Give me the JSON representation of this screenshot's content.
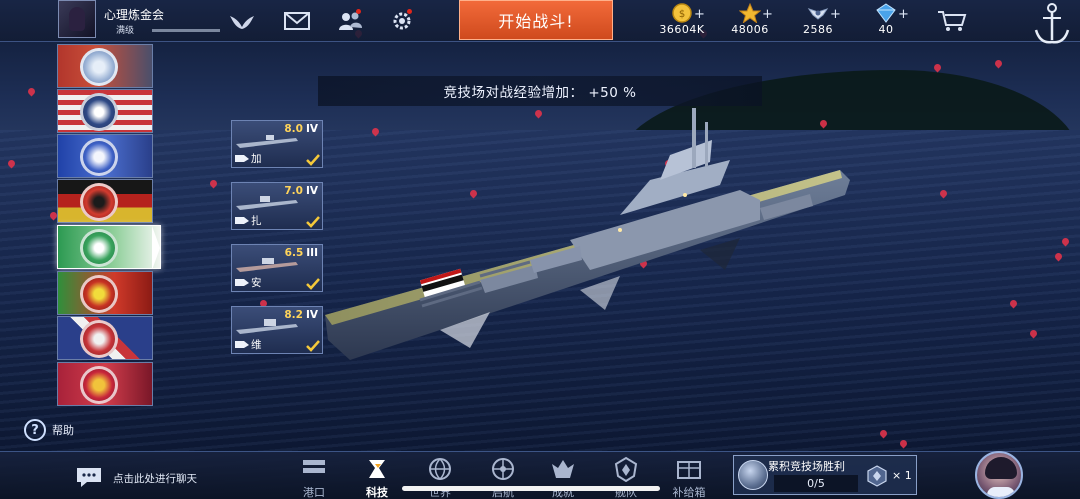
{
  "player": {
    "name": "心理炼金会",
    "level_text": "满级"
  },
  "top": {
    "start_battle_label": "开始战斗!"
  },
  "resources": [
    {
      "icon": "gold-coin-icon",
      "value": "36604K",
      "plus": "+"
    },
    {
      "icon": "star-icon",
      "value": "48006",
      "plus": "+"
    },
    {
      "icon": "wing-emblem-icon",
      "value": "2586",
      "plus": "+"
    },
    {
      "icon": "diamond-icon",
      "value": "40",
      "plus": "+"
    }
  ],
  "banner": {
    "text": "竞技场对战经验增加：  +50 %"
  },
  "nations": [
    "uk",
    "usa",
    "france",
    "germany",
    "italy",
    "japan-soviet",
    "commonwealth",
    "pan-asia"
  ],
  "active_nation_index": 4,
  "ship_cards": [
    {
      "tier": "8.0",
      "roman": "IV",
      "name": "加"
    },
    {
      "tier": "7.0",
      "roman": "IV",
      "name": "扎"
    },
    {
      "tier": "6.5",
      "roman": "III",
      "name": "安"
    },
    {
      "tier": "8.2",
      "roman": "IV",
      "name": "维"
    }
  ],
  "help_label": "帮助",
  "chat_label": "点击此处进行聊天",
  "nav": [
    {
      "label": "港口",
      "icon": "port-icon",
      "active": false
    },
    {
      "label": "科技",
      "icon": "tech-icon",
      "active": true
    },
    {
      "label": "世界",
      "icon": "world-icon",
      "active": false
    },
    {
      "label": "启航",
      "icon": "sail-icon",
      "active": false
    },
    {
      "label": "成就",
      "icon": "achievement-icon",
      "active": false
    },
    {
      "label": "舰队",
      "icon": "fleet-icon",
      "active": false
    },
    {
      "label": "补给箱",
      "icon": "supply-box-icon",
      "active": false
    }
  ],
  "arena": {
    "title": "累积竞技场胜利",
    "progress": "0/5",
    "reward_count": "× 1"
  },
  "colors": {
    "accent_orange": "#e05a2b",
    "tier_gold": "#ffd45a",
    "check_yellow": "#f5c93a",
    "petal_red": "#e0334a"
  }
}
